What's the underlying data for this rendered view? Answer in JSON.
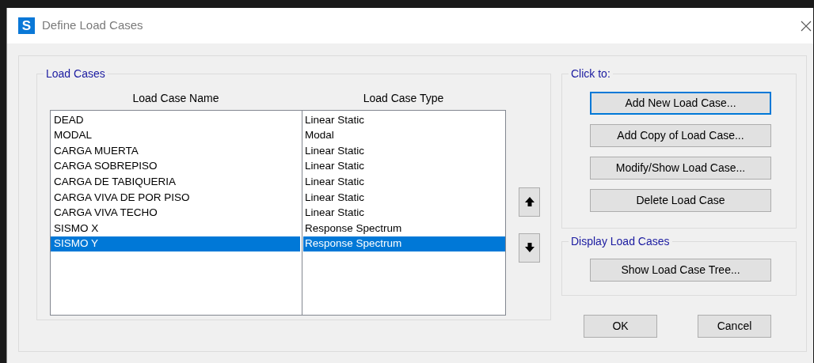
{
  "window": {
    "title": "Define Load Cases",
    "app_icon": "S"
  },
  "load_cases": {
    "label": "Load Cases",
    "columns": [
      "Load Case Name",
      "Load Case Type"
    ],
    "rows": [
      {
        "name": "DEAD",
        "type": "Linear Static",
        "selected": false
      },
      {
        "name": "MODAL",
        "type": "Modal",
        "selected": false
      },
      {
        "name": "CARGA MUERTA",
        "type": "Linear Static",
        "selected": false
      },
      {
        "name": "CARGA SOBREPISO",
        "type": "Linear Static",
        "selected": false
      },
      {
        "name": "CARGA DE TABIQUERIA",
        "type": "Linear Static",
        "selected": false
      },
      {
        "name": "CARGA VIVA DE POR PISO",
        "type": "Linear Static",
        "selected": false
      },
      {
        "name": "CARGA VIVA TECHO",
        "type": "Linear Static",
        "selected": false
      },
      {
        "name": "SISMO X",
        "type": "Response Spectrum",
        "selected": false
      },
      {
        "name": "SISMO Y",
        "type": "Response Spectrum",
        "selected": true
      }
    ]
  },
  "click_to": {
    "label": "Click to:",
    "buttons": [
      {
        "label": "Add New Load Case...",
        "focused": true
      },
      {
        "label": "Add Copy of Load Case...",
        "focused": false
      },
      {
        "label": "Modify/Show Load Case...",
        "focused": false
      },
      {
        "label": "Delete Load Case",
        "focused": false
      }
    ]
  },
  "display_load_cases": {
    "label": "Display Load Cases",
    "button": "Show Load Case Tree..."
  },
  "buttons": [
    "OK",
    "Cancel"
  ]
}
